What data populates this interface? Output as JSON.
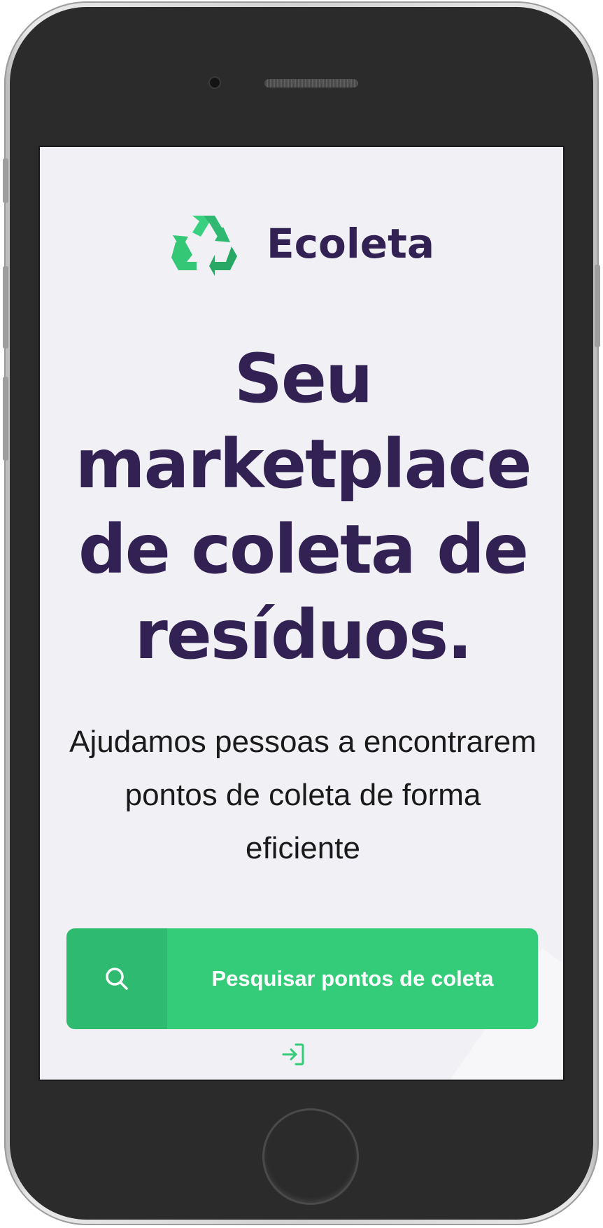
{
  "app": {
    "name": "Ecoleta"
  },
  "hero": {
    "title": "Seu marketplace de coleta de resíduos.",
    "description": "Ajudamos pessoas a encontrarem pontos de coleta de forma eficiente"
  },
  "actions": {
    "search_label": "Pesquisar pontos de coleta",
    "search_icon": "search-icon",
    "login_icon": "login-icon"
  },
  "colors": {
    "primary_green": "#34cb79",
    "title_purple": "#322153",
    "background": "#f0f0f5"
  }
}
